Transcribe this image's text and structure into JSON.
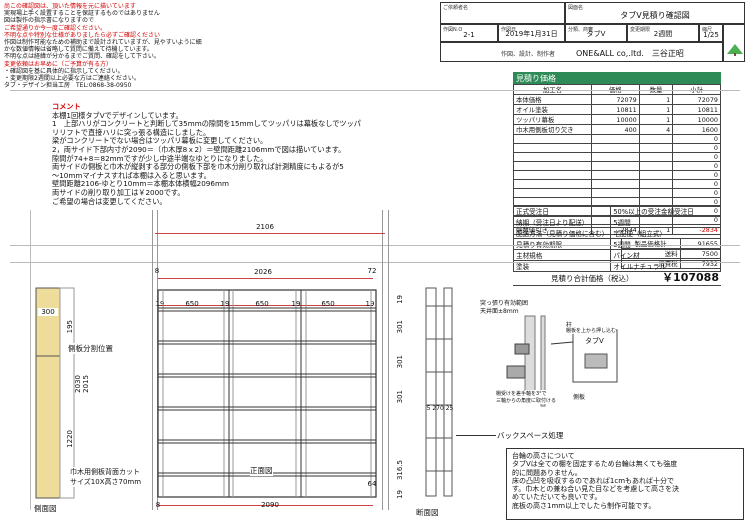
{
  "notice": [
    "尚この確認図は、頂いた情報を元に描いています",
    "実現場上手く設置することを保証するものではありません",
    "図は製作の指示書になりますので",
    "ご希望通りか今一度ご確認ください。",
    "不明な点や特別な仕様がありましたら必ずご確認ください",
    "作図は制作可能なための補助まで設計されていますが、見やすいように細",
    "かな数値情報は省略して質問に備えて待機しています。",
    "不明な点は経緯が分かるまでご質問、確認をして下さい。",
    "変更依頼はお早めに（ご予算が有る方）",
    "・確認図を基に具体的に指示してください。",
    "・変更期限2週間以上必要な方はご連絡ください。",
    "タブ・デザイン担当工房　TEL:0868-38-0950"
  ],
  "titleblock": {
    "client_label": "ご依頼者名",
    "drawing_label": "図面名",
    "drawing_name": "タブV見積り確認図",
    "no_label": "作図N.O",
    "no": "2-1",
    "date_label": "作図日",
    "date": "2019年1月31日",
    "class_label": "分類、商審",
    "class": "タブV",
    "period_label": "変更期限",
    "period": "2週間",
    "scale_label": "縮尺",
    "scale": "1/25",
    "maker_label": "作図、設計、制作者",
    "maker": "ONE&ALL co,.ltd.　三谷正昭"
  },
  "price": {
    "title": "見積り価格",
    "headers": [
      "加工名",
      "価格",
      "数量",
      "小計"
    ],
    "rows": [
      [
        "本体価格",
        "72079",
        "1",
        "72079"
      ],
      [
        "オイル塗装",
        "10811",
        "1",
        "10811"
      ],
      [
        "ツッパリ幕板",
        "10000",
        "1",
        "10000"
      ],
      [
        "巾木用側板切り欠き",
        "400",
        "4",
        "1600"
      ],
      [
        "",
        "",
        "",
        "0"
      ],
      [
        "",
        "",
        "",
        "0"
      ],
      [
        "",
        "",
        "",
        "0"
      ],
      [
        "",
        "",
        "",
        "0"
      ],
      [
        "",
        "",
        "",
        "0"
      ],
      [
        "",
        "",
        "",
        "0"
      ],
      [
        "",
        "",
        "",
        "0"
      ],
      [
        "",
        "",
        "",
        "0"
      ],
      [
        "",
        "",
        "",
        "0"
      ],
      [
        "",
        "",
        "",
        "0"
      ],
      [
        "端数値引き",
        "-2834",
        "1",
        "-2834"
      ]
    ],
    "subtotal_label": "製品価格計",
    "subtotal": "91655",
    "shipping_label": "送料",
    "shipping": "7500",
    "tax_label": "消費税",
    "tax": "7932",
    "total_label": "見積り合計価格（税込）",
    "total": "￥107088"
  },
  "spec": [
    [
      "正式受注日",
      "50%以上の受注金額受注日"
    ],
    [
      "納期（受注日より配送）",
      "5週間"
    ],
    [
      "配送方法（見積り価格に含む）",
      "宅配便（組立式）"
    ],
    [
      "見積り有効期限",
      "5週間"
    ],
    [
      "主材規格",
      "パイン材"
    ],
    [
      "塗装",
      "オイルナチュラル"
    ]
  ],
  "comment": {
    "title": "コメント",
    "lines": [
      "本棚1回様タブVでデザインしています。",
      "1　上部ハリがコンクリートと判断して35mmの隙間を15mmしてツッパリは幕板なしでツッパ",
      "リリフトで直接ハリに突っ張る構造にしました。",
      "梁がコンクリートでない場合はツッパリ幕板に変更してください。",
      "2，両サイド下部内寸が2090＝（巾木厚8ｘ2）＝壁間距離2106mmで図は描いています。",
      "隙間が74+8＝82mmですが少し中途半端なゆとりになりました。",
      "両サイドの側板と巾木が縦剥する部分の側板下部を巾木分削り取れば計測精度にもよるが5",
      "～10mmマイナスすれば本棚は入ると思います。",
      "壁間距離2106-ゆとり10mm＝本棚本体横幅2096mm",
      "両サイドの削り取り加工は￥2000です。",
      "ご希望の場合は変更してください。"
    ]
  },
  "drawing": {
    "side_view_label": "側面図",
    "front_view_label": "正面図",
    "section_view_label": "断面図",
    "side_divider_label": "側板分割位置",
    "baseboard_label_1": "巾木用側板背面カット",
    "baseboard_label_2": "サイズ10X高さ70mm",
    "back_space_label": "バックスペース処理",
    "tension_label_1": "突っ張り有効範囲",
    "tension_label_2": "天井面±8mm",
    "pillar_label": "柱",
    "side_board_label": "側板",
    "pole_label": "側板",
    "pillar_note": "棚板を上から押し込む",
    "tabv_tag": "タブV",
    "bracket_note": "棚受けを差手軸を3°で\n三軸からの角度に取付ける",
    "dims": {
      "overall_top": "2106",
      "inner": "2026",
      "left_8": "8",
      "right_72": "72",
      "bottom": "2090",
      "bottom_8": "8",
      "col_650a": "650",
      "col_650b": "650",
      "col_650c": "650",
      "col_19a": "19",
      "col_19b": "19",
      "col_19c": "19",
      "col_19d": "19",
      "side_300": "300",
      "side_195": "195",
      "side_2030": "2030",
      "side_2015": "2015",
      "side_1220": "1220",
      "side_64": "64",
      "sec_19": "19",
      "sec_301": "301",
      "sec_301b": "301",
      "sec_301c": "301",
      "sec_270": "5  270 25",
      "sec_316": "316.5",
      "sec_bottom_19": "19"
    }
  },
  "note": {
    "lines": [
      "台輪の高さについて",
      "タブVは全ての棚を固定するため台輪は無くても強度",
      "的に問題ありません。",
      "床の凸凹を吸収するのであれば1cmもあれば十分で",
      "す。巾木との兼ね合い見た目などを考慮して高さを決",
      "めていただいても良いです。",
      "底板の高さ1mm以上でしたら制作可能です。"
    ]
  }
}
